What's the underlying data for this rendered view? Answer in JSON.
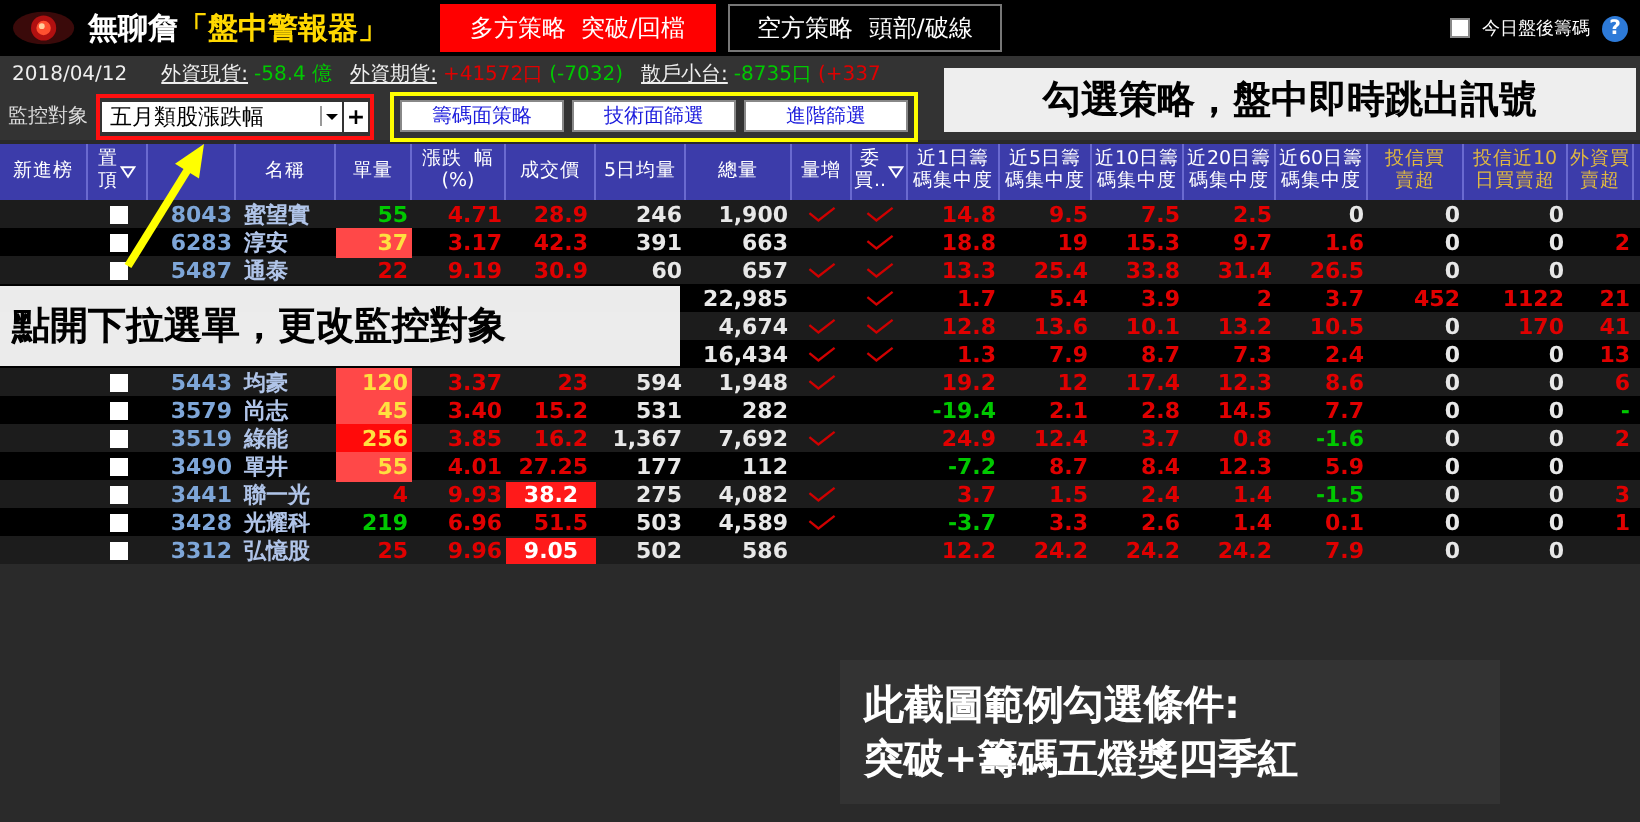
{
  "app": {
    "title": "無聊詹",
    "accent": "「盤中警報器」"
  },
  "strategy_tabs": [
    {
      "label": "多方策略  突破/回檔",
      "selected": true
    },
    {
      "label": "空方策略  頭部/破線",
      "selected": false
    }
  ],
  "after_hours": {
    "label": "今日盤後籌碼",
    "checked": false
  },
  "help": "?",
  "info_bar": {
    "date": "2018/04/12",
    "items": [
      {
        "label": "外資現貨:",
        "parts": [
          {
            "text": "-58.4 億",
            "color": "#00c800"
          }
        ]
      },
      {
        "label": "外資期貨:",
        "parts": [
          {
            "text": "+41572口",
            "color": "#e00000"
          },
          {
            "text": "(-7032)",
            "color": "#00c800"
          }
        ]
      },
      {
        "label": "散戶小台:",
        "parts": [
          {
            "text": "-8735口",
            "color": "#00c800"
          },
          {
            "text": "(+337",
            "color": "#e00000"
          }
        ]
      }
    ]
  },
  "monitor": {
    "label": "監控對象",
    "value": "五月類股漲跌幅",
    "add": "+"
  },
  "filter_buttons": [
    "籌碼面策略",
    "技術面篩選",
    "進階篩選"
  ],
  "columns": [
    {
      "lines": [
        "新進榜"
      ]
    },
    {
      "lines": [
        "置",
        "頂"
      ],
      "filter": true
    },
    {
      "lines": [
        "名稱"
      ]
    },
    {
      "lines": [
        "單量"
      ]
    },
    {
      "lines": [
        "漲跌  幅",
        "(%)"
      ]
    },
    {
      "lines": [
        "成交價"
      ]
    },
    {
      "lines": [
        "5日均量"
      ]
    },
    {
      "lines": [
        "總量"
      ]
    },
    {
      "lines": [
        "量增"
      ]
    },
    {
      "lines": [
        "委",
        "買.."
      ],
      "filter": true
    },
    {
      "lines": [
        "近1日籌",
        "碼集中度"
      ]
    },
    {
      "lines": [
        "近5日籌",
        "碼集中度"
      ]
    },
    {
      "lines": [
        "近10日籌",
        "碼集中度"
      ]
    },
    {
      "lines": [
        "近20日籌",
        "碼集中度"
      ]
    },
    {
      "lines": [
        "近60日籌",
        "碼集中度"
      ]
    },
    {
      "lines": [
        "投信買",
        "賣超"
      ],
      "gold": true
    },
    {
      "lines": [
        "投信近10",
        "日買賣超"
      ],
      "gold": true
    },
    {
      "lines": [
        "外資買",
        "賣超"
      ],
      "gold": true
    }
  ],
  "rows": [
    {
      "pinned": false,
      "code": "8043",
      "name": "蜜望實",
      "vol": {
        "value": "55",
        "kind": "down"
      },
      "chg": "4.71",
      "price": {
        "value": "28.9",
        "limit": false
      },
      "avg5": "246",
      "total": "1,900",
      "vol_up": true,
      "bid": true,
      "stats": [
        {
          "v": "14.8",
          "color": "#e00000"
        },
        {
          "v": "9.5",
          "color": "#e00000"
        },
        {
          "v": "7.5",
          "color": "#e00000"
        },
        {
          "v": "2.5",
          "color": "#e00000"
        },
        {
          "v": "0",
          "color": "#e8e8e8"
        },
        {
          "v": "0",
          "color": "#e8e8e8"
        },
        {
          "v": "0",
          "color": "#e8e8e8"
        }
      ]
    },
    {
      "pinned": false,
      "code": "6283",
      "name": "淳安",
      "vol": {
        "value": "37",
        "kind": "alert"
      },
      "chg": "3.17",
      "price": {
        "value": "42.3",
        "limit": false
      },
      "avg5": "391",
      "total": "663",
      "vol_up": false,
      "bid": true,
      "stats": [
        {
          "v": "18.8",
          "color": "#e00000"
        },
        {
          "v": "19",
          "color": "#e00000"
        },
        {
          "v": "15.3",
          "color": "#e00000"
        },
        {
          "v": "9.7",
          "color": "#e00000"
        },
        {
          "v": "1.6",
          "color": "#e00000"
        },
        {
          "v": "0",
          "color": "#e8e8e8"
        },
        {
          "v": "0",
          "color": "#e8e8e8"
        },
        {
          "v": "2",
          "color": "#e00000"
        }
      ]
    },
    {
      "pinned": false,
      "code": "5487",
      "name": "通泰",
      "vol": {
        "value": "22",
        "kind": "up"
      },
      "chg": "9.19",
      "price": {
        "value": "30.9",
        "limit": false
      },
      "avg5": "60",
      "total": "657",
      "vol_up": true,
      "bid": true,
      "stats": [
        {
          "v": "13.3",
          "color": "#e00000"
        },
        {
          "v": "25.4",
          "color": "#e00000"
        },
        {
          "v": "33.8",
          "color": "#e00000"
        },
        {
          "v": "31.4",
          "color": "#e00000"
        },
        {
          "v": "26.5",
          "color": "#e00000"
        },
        {
          "v": "0",
          "color": "#e8e8e8"
        },
        {
          "v": "0",
          "color": "#e8e8e8"
        }
      ]
    },
    {
      "total": "22,985",
      "vol_up": false,
      "bid": true,
      "stats": [
        {
          "v": "1.7",
          "color": "#e00000"
        },
        {
          "v": "5.4",
          "color": "#e00000"
        },
        {
          "v": "3.9",
          "color": "#e00000"
        },
        {
          "v": "2",
          "color": "#e00000"
        },
        {
          "v": "3.7",
          "color": "#e00000"
        },
        {
          "v": "452",
          "color": "#e00000"
        },
        {
          "v": "1122",
          "color": "#e00000"
        },
        {
          "v": "21",
          "color": "#e00000"
        }
      ]
    },
    {
      "total": "4,674",
      "vol_up": true,
      "bid": true,
      "stats": [
        {
          "v": "12.8",
          "color": "#e00000"
        },
        {
          "v": "13.6",
          "color": "#e00000"
        },
        {
          "v": "10.1",
          "color": "#e00000"
        },
        {
          "v": "13.2",
          "color": "#e00000"
        },
        {
          "v": "10.5",
          "color": "#e00000"
        },
        {
          "v": "0",
          "color": "#e8e8e8"
        },
        {
          "v": "170",
          "color": "#e00000"
        },
        {
          "v": "41",
          "color": "#e00000"
        }
      ]
    },
    {
      "total": "16,434",
      "vol_up": true,
      "bid": true,
      "stats": [
        {
          "v": "1.3",
          "color": "#e00000"
        },
        {
          "v": "7.9",
          "color": "#e00000"
        },
        {
          "v": "8.7",
          "color": "#e00000"
        },
        {
          "v": "7.3",
          "color": "#e00000"
        },
        {
          "v": "2.4",
          "color": "#e00000"
        },
        {
          "v": "0",
          "color": "#e8e8e8"
        },
        {
          "v": "0",
          "color": "#e8e8e8"
        },
        {
          "v": "13",
          "color": "#e00000"
        }
      ]
    },
    {
      "pinned": false,
      "code": "5443",
      "name": "均豪",
      "vol": {
        "value": "120",
        "kind": "alert"
      },
      "chg": "3.37",
      "price": {
        "value": "23",
        "limit": false
      },
      "avg5": "594",
      "total": "1,948",
      "vol_up": true,
      "bid": false,
      "stats": [
        {
          "v": "19.2",
          "color": "#e00000"
        },
        {
          "v": "12",
          "color": "#e00000"
        },
        {
          "v": "17.4",
          "color": "#e00000"
        },
        {
          "v": "12.3",
          "color": "#e00000"
        },
        {
          "v": "8.6",
          "color": "#e00000"
        },
        {
          "v": "0",
          "color": "#e8e8e8"
        },
        {
          "v": "0",
          "color": "#e8e8e8"
        },
        {
          "v": "6",
          "color": "#e00000"
        }
      ]
    },
    {
      "pinned": false,
      "code": "3579",
      "name": "尚志",
      "vol": {
        "value": "45",
        "kind": "alert"
      },
      "chg": "3.40",
      "price": {
        "value": "15.2",
        "limit": false
      },
      "avg5": "531",
      "total": "282",
      "vol_up": false,
      "bid": false,
      "stats": [
        {
          "v": "-19.4",
          "color": "#00c800"
        },
        {
          "v": "2.1",
          "color": "#e00000"
        },
        {
          "v": "2.8",
          "color": "#e00000"
        },
        {
          "v": "14.5",
          "color": "#e00000"
        },
        {
          "v": "7.7",
          "color": "#e00000"
        },
        {
          "v": "0",
          "color": "#e8e8e8"
        },
        {
          "v": "0",
          "color": "#e8e8e8"
        },
        {
          "v": "-",
          "color": "#00c800"
        }
      ]
    },
    {
      "pinned": false,
      "code": "3519",
      "name": "綠能",
      "vol": {
        "value": "256",
        "kind": "strong"
      },
      "chg": "3.85",
      "price": {
        "value": "16.2",
        "limit": false
      },
      "avg5": "1,367",
      "total": "7,692",
      "vol_up": true,
      "bid": false,
      "stats": [
        {
          "v": "24.9",
          "color": "#e00000"
        },
        {
          "v": "12.4",
          "color": "#e00000"
        },
        {
          "v": "3.7",
          "color": "#e00000"
        },
        {
          "v": "0.8",
          "color": "#e00000"
        },
        {
          "v": "-1.6",
          "color": "#00c800"
        },
        {
          "v": "0",
          "color": "#e8e8e8"
        },
        {
          "v": "0",
          "color": "#e8e8e8"
        },
        {
          "v": "2",
          "color": "#e00000"
        }
      ]
    },
    {
      "pinned": false,
      "code": "3490",
      "name": "單井",
      "vol": {
        "value": "55",
        "kind": "alert"
      },
      "chg": "4.01",
      "price": {
        "value": "27.25",
        "limit": false
      },
      "avg5": "177",
      "total": "112",
      "vol_up": false,
      "bid": false,
      "stats": [
        {
          "v": "-7.2",
          "color": "#00c800"
        },
        {
          "v": "8.7",
          "color": "#e00000"
        },
        {
          "v": "8.4",
          "color": "#e00000"
        },
        {
          "v": "12.3",
          "color": "#e00000"
        },
        {
          "v": "5.9",
          "color": "#e00000"
        },
        {
          "v": "0",
          "color": "#e8e8e8"
        },
        {
          "v": "0",
          "color": "#e8e8e8"
        }
      ]
    },
    {
      "pinned": false,
      "code": "3441",
      "name": "聯一光",
      "vol": {
        "value": "4",
        "kind": "up"
      },
      "chg": "9.93",
      "price": {
        "value": "38.2",
        "limit": true
      },
      "avg5": "275",
      "total": "4,082",
      "vol_up": true,
      "bid": false,
      "stats": [
        {
          "v": "3.7",
          "color": "#e00000"
        },
        {
          "v": "1.5",
          "color": "#e00000"
        },
        {
          "v": "2.4",
          "color": "#e00000"
        },
        {
          "v": "1.4",
          "color": "#e00000"
        },
        {
          "v": "-1.5",
          "color": "#00c800"
        },
        {
          "v": "0",
          "color": "#e8e8e8"
        },
        {
          "v": "0",
          "color": "#e8e8e8"
        },
        {
          "v": "3",
          "color": "#e00000"
        }
      ]
    },
    {
      "pinned": false,
      "code": "3428",
      "name": "光耀科",
      "vol": {
        "value": "219",
        "kind": "down"
      },
      "chg": "6.96",
      "price": {
        "value": "51.5",
        "limit": false
      },
      "avg5": "503",
      "total": "4,589",
      "vol_up": true,
      "bid": false,
      "stats": [
        {
          "v": "-3.7",
          "color": "#00c800"
        },
        {
          "v": "3.3",
          "color": "#e00000"
        },
        {
          "v": "2.6",
          "color": "#e00000"
        },
        {
          "v": "1.4",
          "color": "#e00000"
        },
        {
          "v": "0.1",
          "color": "#e00000"
        },
        {
          "v": "0",
          "color": "#e8e8e8"
        },
        {
          "v": "0",
          "color": "#e8e8e8"
        },
        {
          "v": "1",
          "color": "#e00000"
        }
      ]
    },
    {
      "pinned": false,
      "code": "3312",
      "name": "弘憶股",
      "vol": {
        "value": "25",
        "kind": "up"
      },
      "chg": "9.96",
      "price": {
        "value": "9.05",
        "limit": true
      },
      "avg5": "502",
      "total": "586",
      "vol_up": false,
      "bid": false,
      "stats": [
        {
          "v": "12.2",
          "color": "#e00000"
        },
        {
          "v": "24.2",
          "color": "#e00000"
        },
        {
          "v": "24.2",
          "color": "#e00000"
        },
        {
          "v": "24.2",
          "color": "#e00000"
        },
        {
          "v": "7.9",
          "color": "#e00000"
        },
        {
          "v": "0",
          "color": "#e8e8e8"
        },
        {
          "v": "0",
          "color": "#e8e8e8"
        }
      ]
    }
  ],
  "callouts": [
    {
      "kind": "top",
      "lines": [
        "勾選策略，盤中即時跳出訊號"
      ]
    },
    {
      "kind": "dropdown",
      "lines": [
        "點開下拉選單，更改監控對象"
      ]
    },
    {
      "kind": "note",
      "lines": [
        "此截圖範例勾選條件:",
        "突破+籌碼五燈獎四季紅"
      ]
    }
  ]
}
